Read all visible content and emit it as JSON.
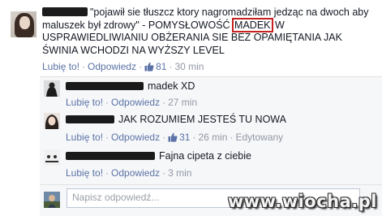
{
  "main_comment": {
    "quote_part1": "\"pojawił sie tłuszcz ktory nagromadziłam jedząc na dwoch aby maluszek był zdrowy\" - POMYSŁOWOŚĆ ",
    "highlight": "MADEK",
    "quote_part2": " W USPRAWIEDLIWIANIU OBŻERANIA SIE BEZ OPAMIĘTANIA JAK ŚWINIA WCHODZI NA WYŻSZY LEVEL",
    "like_label": "Lubię to!",
    "reply_label": "Odpowiedz",
    "like_count": "81",
    "time": "30 min"
  },
  "replies": [
    {
      "text": "madek XD",
      "like_label": "Lubię to!",
      "reply_label": "Odpowiedz",
      "time": "27 min"
    },
    {
      "text": "JAK ROZUMIEM JESTEŚ TU NOWA",
      "like_label": "Lubię to!",
      "reply_label": "Odpowiedz",
      "like_count": "31",
      "time": "26 min",
      "edited": "Edytowany"
    },
    {
      "text": "Fajna cipeta z ciebie",
      "like_label": "Lubię to!",
      "reply_label": "Odpowiedz",
      "time": "3 min"
    }
  ],
  "write_reply": {
    "placeholder": "Napisz odpowiedź..."
  },
  "watermark": "www.wiocha.pl",
  "colors": {
    "link": "#5b73a7",
    "meta": "#9197a3",
    "highlight_border": "#c81f1f",
    "reply_bg": "#f6f7f9"
  },
  "icons": {
    "like": "thumbs-up-icon"
  }
}
